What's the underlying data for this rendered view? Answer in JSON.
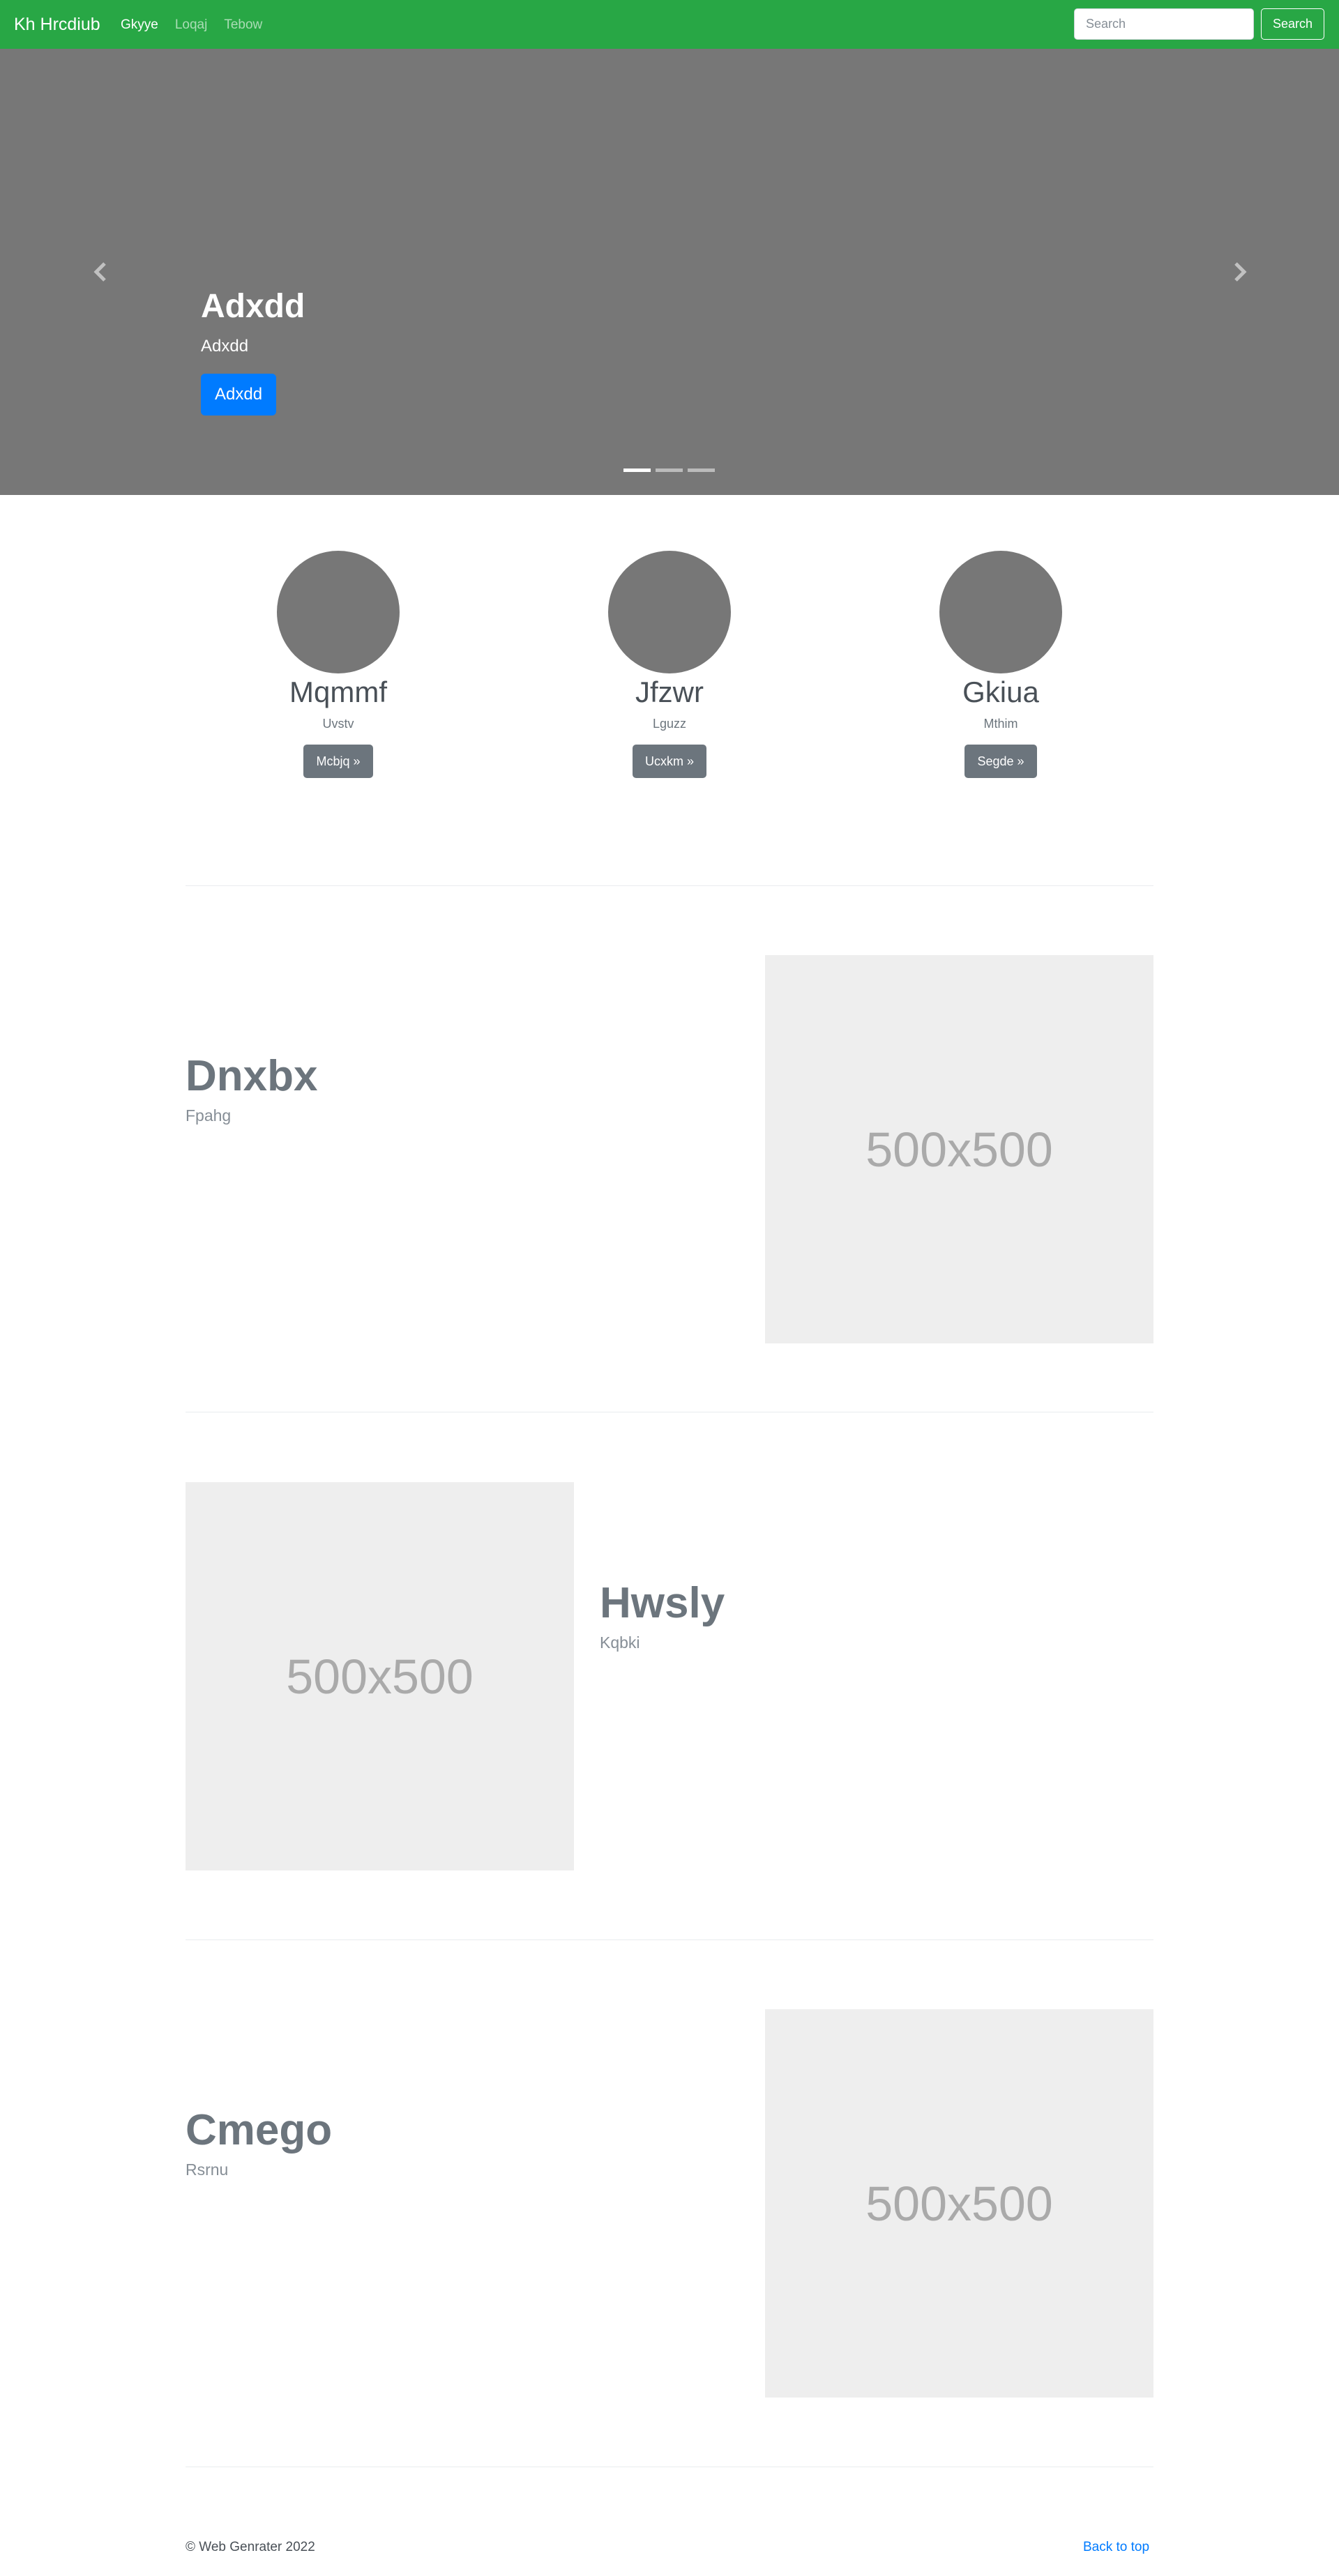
{
  "navbar": {
    "brand": "Kh Hrcdiub",
    "links": [
      {
        "label": "Gkyye",
        "active": true
      },
      {
        "label": "Loqaj",
        "active": false
      },
      {
        "label": "Tebow",
        "active": false
      }
    ],
    "search_placeholder": "Search",
    "search_button": "Search",
    "bg_color": "#28a745"
  },
  "carousel": {
    "title": "Adxdd",
    "text": "Adxdd",
    "button": "Adxdd",
    "prev_icon": "chevron-left-icon",
    "next_icon": "chevron-right-icon",
    "slide_count": 3,
    "active_slide": 1
  },
  "columns": [
    {
      "heading": "Mqmmf",
      "text": "Uvstv",
      "button": "Mcbjq »"
    },
    {
      "heading": "Jfzwr",
      "text": "Lguzz",
      "button": "Ucxkm »"
    },
    {
      "heading": "Gkiua",
      "text": "Mthim",
      "button": "Segde »"
    }
  ],
  "featurettes": [
    {
      "heading": "Dnxbx",
      "lead": "Fpahg",
      "image_label": "500x500"
    },
    {
      "heading": "Hwsly",
      "lead": "Kqbki",
      "image_label": "500x500"
    },
    {
      "heading": "Cmego",
      "lead": "Rsrnu",
      "image_label": "500x500"
    }
  ],
  "footer": {
    "copyright": "© Web Genrater 2022",
    "back_to_top": "Back to top"
  }
}
